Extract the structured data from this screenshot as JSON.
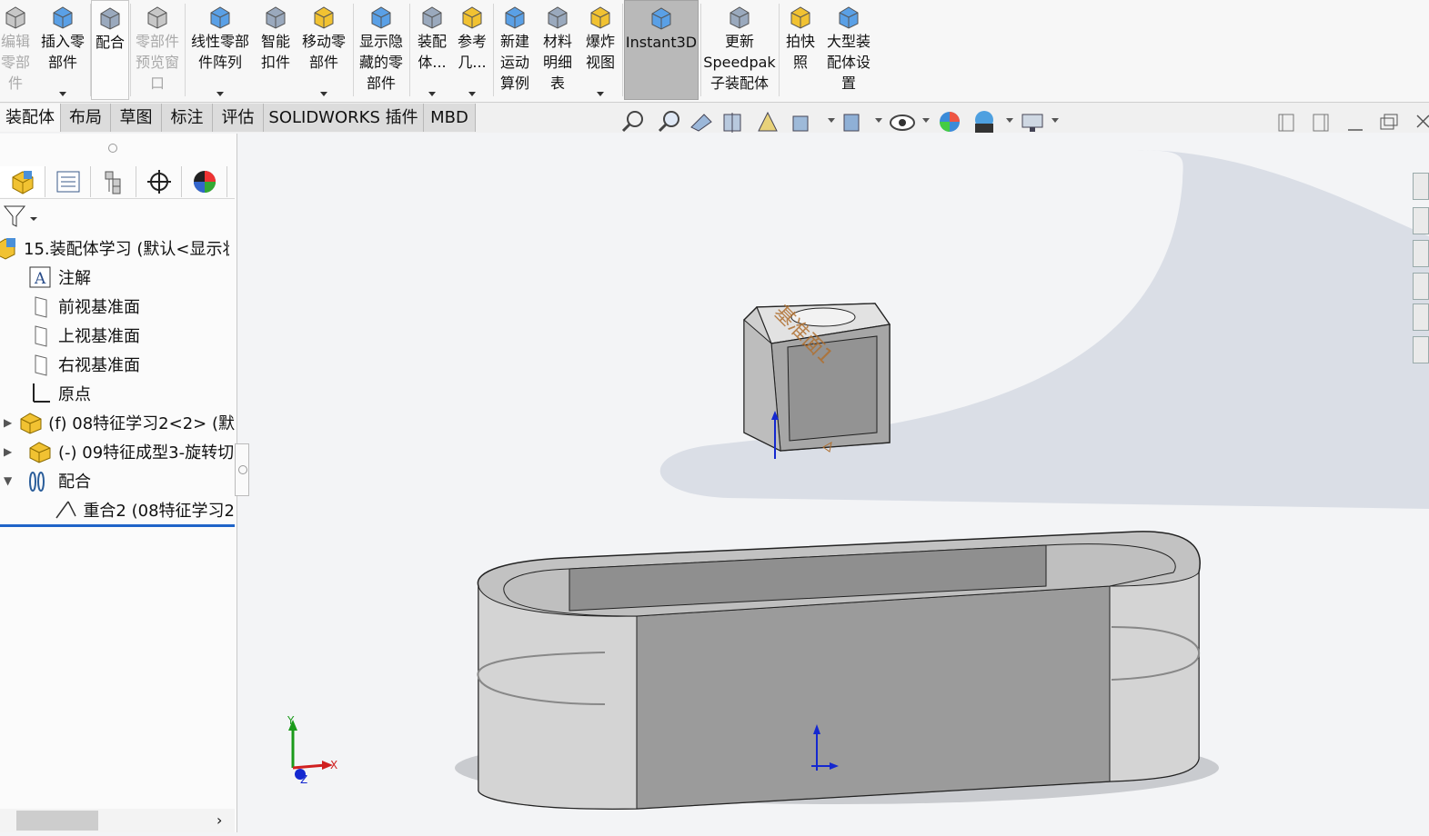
{
  "ribbon": {
    "buttons": [
      {
        "label": "编辑\n零部\n件",
        "disabled": true,
        "icon": "edit-component-icon"
      },
      {
        "label": "插入零\n部件",
        "dropdown": true,
        "icon": "insert-component-icon"
      },
      {
        "label": "配合",
        "icon": "mate-paperclip-icon"
      },
      {
        "label": "零部件\n预览窗\n口",
        "disabled": true,
        "icon": "component-preview-icon"
      },
      {
        "label": "线性零部\n件阵列",
        "dropdown": true,
        "icon": "linear-pattern-icon"
      },
      {
        "label": "智能\n扣件",
        "icon": "smart-fasteners-icon"
      },
      {
        "label": "移动零\n部件",
        "dropdown": true,
        "icon": "move-component-icon"
      },
      {
        "label": "显示隐\n藏的零\n部件",
        "icon": "show-hidden-icon"
      },
      {
        "label": "装配\n体...",
        "dropdown": true,
        "icon": "assembly-features-icon"
      },
      {
        "label": "参考\n几...",
        "dropdown": true,
        "icon": "reference-geometry-icon"
      },
      {
        "label": "新建\n运动\n算例",
        "icon": "motion-study-icon"
      },
      {
        "label": "材料\n明细\n表",
        "icon": "bom-icon"
      },
      {
        "label": "爆炸\n视图",
        "dropdown": true,
        "icon": "exploded-view-icon"
      },
      {
        "label": "Instant3D",
        "active": true,
        "icon": "instant3d-icon"
      },
      {
        "label": "更新\nSpeedpak\n子装配体",
        "icon": "speedpak-icon"
      },
      {
        "label": "拍快\n照",
        "icon": "snapshot-camera-icon"
      },
      {
        "label": "大型装\n配体设\n置",
        "icon": "large-assembly-icon"
      }
    ]
  },
  "tabs": [
    "装配体",
    "布局",
    "草图",
    "标注",
    "评估",
    "SOLIDWORKS 插件",
    "MBD"
  ],
  "feature_tree": {
    "root": "15.装配体学习  (默认<显示状",
    "items": [
      {
        "label": "注解",
        "icon": "annotations-icon"
      },
      {
        "label": "前视基准面",
        "icon": "plane-icon"
      },
      {
        "label": "上视基准面",
        "icon": "plane-icon"
      },
      {
        "label": "右视基准面",
        "icon": "plane-icon"
      },
      {
        "label": "原点",
        "icon": "origin-icon"
      },
      {
        "label": "(f) 08特征学习2<2> (默",
        "icon": "part-icon",
        "expand": "▶"
      },
      {
        "label": "(-) 09特征成型3-旋转切",
        "icon": "part-icon",
        "expand": "▶"
      },
      {
        "label": "配合",
        "icon": "mates-folder-icon",
        "expand": "▼"
      },
      {
        "label": "重合2 (08特征学习2",
        "icon": "coincident-mate-icon"
      }
    ]
  },
  "viewport": {
    "plane_label": "基准面1",
    "triad": {
      "x": "X",
      "y": "Y",
      "z": "Z"
    }
  },
  "colors": {
    "accent_blue": "#1f64c8",
    "model_gray": "#9b9b9b",
    "plane_label": "#b07030",
    "ground_shadow": "#d8dde6"
  }
}
